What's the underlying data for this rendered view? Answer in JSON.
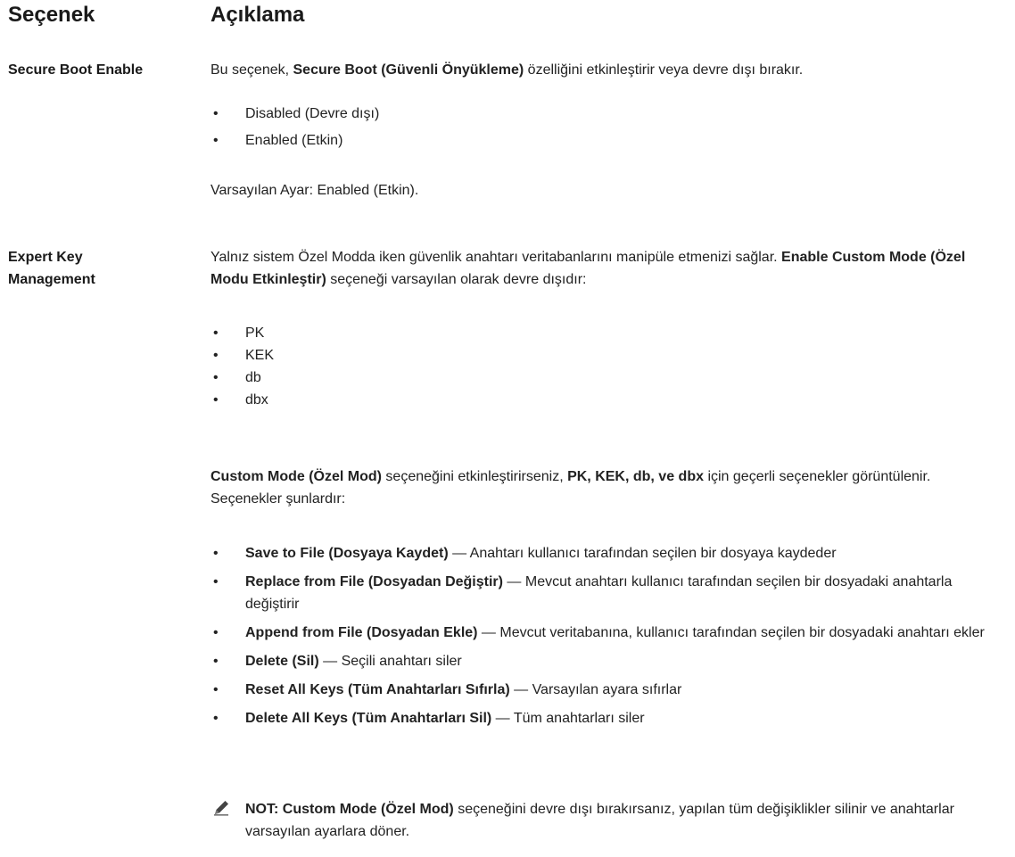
{
  "header": {
    "option": "Seçenek",
    "description": "Açıklama"
  },
  "secure_boot": {
    "option": "Secure Boot Enable",
    "desc_prefix": "Bu seçenek, ",
    "desc_bold": "Secure Boot (Güvenli Önyükleme)",
    "desc_suffix": " özelliğini etkinleştirir veya devre dışı bırakır.",
    "items": [
      "Disabled (Devre dışı)",
      "Enabled (Etkin)"
    ],
    "default": "Varsayılan Ayar: Enabled (Etkin)."
  },
  "expert_key": {
    "option_line1": "Expert Key",
    "option_line2": "Management",
    "desc_prefix": "Yalnız sistem Özel Modda iken güvenlik anahtarı veritabanlarını manipüle etmenizi sağlar. ",
    "desc_bold": "Enable Custom Mode (Özel Modu Etkinleştir)",
    "desc_suffix": " seçeneği varsayılan olarak devre dışıdır:",
    "keys": [
      "PK",
      "KEK",
      "db",
      "dbx"
    ],
    "custom_bold1": "Custom Mode (Özel Mod)",
    "custom_text1": " seçeneğini etkinleştirirseniz, ",
    "custom_bold2": "PK, KEK, db, ve dbx",
    "custom_text2": " için geçerli seçenekler görüntülenir. Seçenekler şunlardır:",
    "actions": [
      {
        "name": "Save to File (Dosyaya Kaydet)",
        "text": " — Anahtarı kullanıcı tarafından seçilen bir dosyaya kaydeder"
      },
      {
        "name": "Replace from File (Dosyadan Değiştir)",
        "text": " — Mevcut anahtarı kullanıcı tarafından seçilen bir dosyadaki anahtarla değiştirir"
      },
      {
        "name": "Append from File (Dosyadan Ekle)",
        "text": " — Mevcut veritabanına, kullanıcı tarafından seçilen bir dosyadaki anahtarı ekler"
      },
      {
        "name": "Delete (Sil)",
        "text": " — Seçili anahtarı siler"
      },
      {
        "name": "Reset All Keys (Tüm Anahtarları Sıfırla)",
        "text": " — Varsayılan ayara sıfırlar"
      },
      {
        "name": "Delete All Keys (Tüm Anahtarları Sil)",
        "text": " — Tüm anahtarları siler"
      }
    ],
    "note_bold": "NOT: Custom Mode (Özel Mod)",
    "note_text": " seçeneğini devre dışı bırakırsanız, yapılan tüm değişiklikler silinir ve anahtarlar varsayılan ayarlara döner."
  },
  "bullet_char": "•",
  "icons": {
    "note": "pencil-note-icon"
  },
  "colors": {
    "text": "#222222",
    "icon": "#444444"
  }
}
